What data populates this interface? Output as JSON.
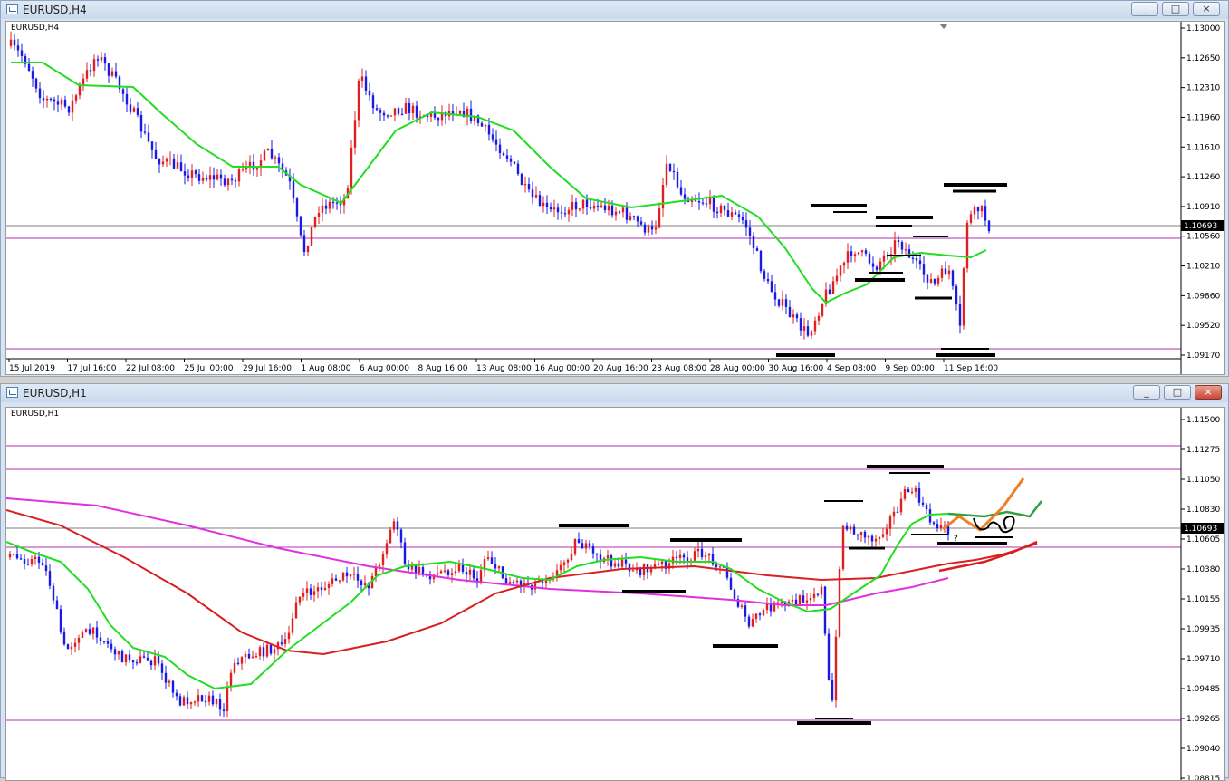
{
  "window_top": {
    "title": "EURUSD,H4",
    "chart_label": "EURUSD,H4",
    "current_price": "1.10693",
    "price_ticks": [
      "1.13000",
      "1.12650",
      "1.12310",
      "1.11960",
      "1.11610",
      "1.11260",
      "1.10910",
      "1.10560",
      "1.10210",
      "1.09860",
      "1.09520",
      "1.09170"
    ],
    "time_ticks": [
      "15 Jul 2019",
      "17 Jul 16:00",
      "22 Jul 08:00",
      "25 Jul 00:00",
      "29 Jul 16:00",
      "1 Aug 08:00",
      "6 Aug 00:00",
      "8 Aug 16:00",
      "13 Aug 08:00",
      "16 Aug 00:00",
      "20 Aug 16:00",
      "23 Aug 08:00",
      "28 Aug 00:00",
      "30 Aug 16:00",
      "4 Sep 08:00",
      "9 Sep 00:00",
      "11 Sep 16:00"
    ],
    "buttons": {
      "minimize": "_",
      "maximize": "□",
      "close": "×"
    }
  },
  "window_bottom": {
    "title": "EURUSD,H1",
    "chart_label": "EURUSD,H1",
    "current_price": "1.10693",
    "price_ticks": [
      "1.11500",
      "1.11275",
      "1.11050",
      "1.10830",
      "1.10605",
      "1.10380",
      "1.10155",
      "1.09935",
      "1.09710",
      "1.09485",
      "1.09265",
      "1.09040",
      "1.08815"
    ],
    "annotation_text": "?",
    "buttons": {
      "minimize": "_",
      "maximize": "□",
      "close": "×"
    }
  },
  "colors": {
    "bull": "#e02020",
    "bear": "#1a1ae6",
    "ma_green": "#22dd22",
    "ma_red": "#d82020",
    "ma_magenta": "#e030e0",
    "hline_magenta": "#b030b0",
    "hline_gray": "#808080",
    "drawn_orange": "#f08020",
    "drawn_green": "#30a040"
  }
}
